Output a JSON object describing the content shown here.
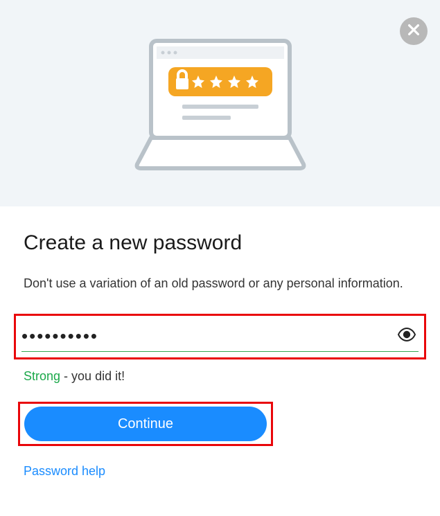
{
  "header": {
    "title": "Create a new password",
    "subtitle": "Don't use a variation of an old password or any personal information."
  },
  "password": {
    "value": "••••••••••",
    "strength_label": "Strong",
    "strength_suffix": " - you did it!"
  },
  "actions": {
    "continue_label": "Continue",
    "help_label": "Password help"
  },
  "colors": {
    "accent_blue": "#1a8cff",
    "success_green": "#1ba84a",
    "highlight_red": "#e9060a",
    "hero_bg": "#f1f5f8",
    "illustration_orange": "#f5a623"
  }
}
